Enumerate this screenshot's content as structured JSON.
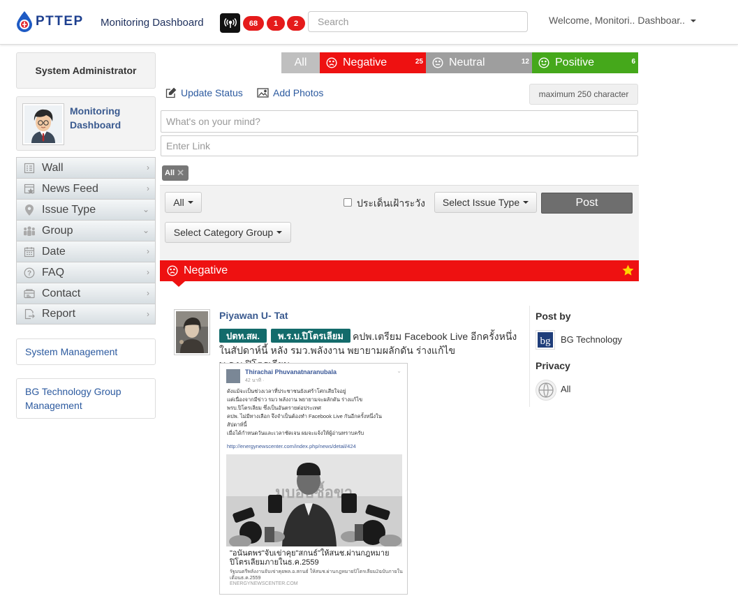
{
  "header": {
    "logo_text": "PTTEP",
    "app_title": "Monitoring Dashboard",
    "badges": [
      "68",
      "1",
      "2"
    ],
    "search_placeholder": "Search",
    "welcome": "Welcome, Monitori.. Dashboar.."
  },
  "sidebar": {
    "role": "System Administrator",
    "profile_name": "Monitoring Dashboard",
    "menu": [
      {
        "label": "Wall",
        "icon": "wall-icon"
      },
      {
        "label": "News Feed",
        "icon": "news-feed-icon"
      },
      {
        "label": "Issue Type",
        "icon": "map-pin-icon"
      },
      {
        "label": "Group",
        "icon": "group-icon"
      },
      {
        "label": "Date",
        "icon": "calendar-icon"
      },
      {
        "label": "FAQ",
        "icon": "question-icon"
      },
      {
        "label": "Contact",
        "icon": "contact-card-icon"
      },
      {
        "label": "Report",
        "icon": "report-export-icon"
      }
    ],
    "links": [
      "System Management",
      "BG Technology Group Management"
    ]
  },
  "filters": {
    "all": "All",
    "negative": {
      "label": "Negative",
      "count": "25",
      "color": "#ee1111"
    },
    "neutral": {
      "label": "Neutral",
      "count": "12",
      "color": "#9e9e9e"
    },
    "positive": {
      "label": "Positive",
      "count": "6",
      "color": "#45a81b"
    }
  },
  "composer": {
    "update_status": "Update Status",
    "add_photos": "Add Photos",
    "max_chars": "maximum 250 character",
    "status_placeholder": "What's on your mind?",
    "link_placeholder": "Enter Link",
    "tag_all": "All",
    "dropdown_all": "All",
    "checkbox_label": "ประเด็นเฝ้าระวัง",
    "issue_type": "Select Issue Type",
    "post": "Post",
    "category_group": "Select Category Group"
  },
  "section": {
    "title": "Negative"
  },
  "post": {
    "author": "Piyawan U- Tat",
    "tags": [
      "ปตท.สผ.",
      "พ.ร.บ.ปิโตรเลียม"
    ],
    "text": "คปพ.เตรียม Facebook Live อีกครั้งหนึ่งในสัปดาห์นี้ หลัง รมว.พลังงาน พยายามผลักดัน ร่างแก้ไข พ.ร.บ.ปิโตรเลียม",
    "card": {
      "name": "Thirachai Phuvanatnaranubala",
      "time": "42 นาที · ",
      "lines": [
        "ดังแม้จะเป็นช่วงเวลาที่ประชาชนยังเศร้าโศกเสียใจอยู่",
        "แต่เนื่องจากมีข่าว รมว พลังงาน พยายามจะผลักดัน ร่างแก้ไข",
        "พรบ.ปิโตรเลียม ซึ่งเป็นอันตรายต่อประเทศ",
        "คปพ. ไม่มีทางเลือก จึงจำเป็นต้องทำ Facebook Live กันอีกครั้งหนึ่งใน",
        "สัปดาห์นี้",
        "เมื่อได้กำหนดวันและเวลาชัดเจน ผมจะแจ้งให้ผู้อ่านทราบครับ"
      ],
      "link": "http://energynewscenter.com/index.php/news/detail/424",
      "news_title": "\"อนันตพร\"จับเข่าคุย\"สกนธ์\"ให้สนช.ผ่านกฎหมายปิโตรเลียมภายในธ.ค.2559",
      "news_desc": "รัฐมนตรีพลังงานจับเข่าคุยพล.อ.สกนธ์ ให้สนช.ผ่านกฎหมายปิโตรเลียม2ฉบับภายในเดือนธ.ค.2559",
      "news_source": "ENERGYNEWSCENTER.COM"
    },
    "post_by_label": "Post by",
    "post_by": "BG Technology",
    "privacy_label": "Privacy",
    "privacy": "All"
  }
}
